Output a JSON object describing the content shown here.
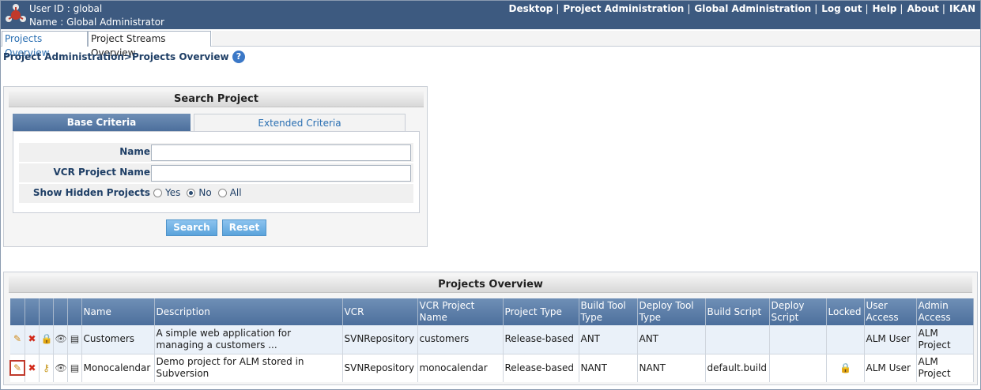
{
  "header": {
    "user_id": "User ID : global",
    "name": "Name : Global Administrator",
    "nav": [
      "Desktop",
      "Project Administration",
      "Global Administration",
      "Log out",
      "Help",
      "About",
      "IKAN"
    ],
    "nav_separator": "|",
    "bg_color": "#3d5a80"
  },
  "tabs": [
    "Projects Overview",
    "Project Streams Overview"
  ],
  "breadcrumb": "Project Administration>Projects Overview",
  "help_icon": "?",
  "search": {
    "title": "Search Project",
    "tab_base": "Base Criteria",
    "tab_extended": "Extended Criteria",
    "name_label": "Name",
    "name_value": "",
    "vcr_label": "VCR Project Name",
    "vcr_value": "",
    "hidden_label": "Show Hidden Projects",
    "options": [
      "Yes",
      "No",
      "All"
    ],
    "selected_option": "No",
    "search_button": "Search",
    "reset_button": "Reset"
  },
  "projects": {
    "title": "Projects Overview",
    "columns": [
      "",
      "",
      "",
      "",
      "",
      "Name",
      "Description",
      "VCR",
      "VCR Project Name",
      "Project Type",
      "Build Tool Type",
      "Deploy Tool Type",
      "Build Script",
      "Deploy Script",
      "Locked",
      "User Access",
      "Admin Access"
    ],
    "rows": [
      {
        "name": "Customers",
        "description": "A simple web application for managing a customers ...",
        "vcr": "SVNRepository",
        "vcr_project_name": "customers",
        "project_type": "Release-based",
        "build_tool_type": "ANT",
        "deploy_tool_type": "ANT",
        "build_script": "",
        "deploy_script": "",
        "locked": "",
        "user_access": "ALM User",
        "admin_access": "ALM Project",
        "icons": [
          "edit-icon",
          "delete-icon",
          "lock-icon",
          "view-icon",
          "details-icon"
        ]
      },
      {
        "name": "Monocalendar",
        "description": "Demo project for ALM stored in Subversion",
        "vcr": "SVNRepository",
        "vcr_project_name": "monocalendar",
        "project_type": "Release-based",
        "build_tool_type": "NANT",
        "deploy_tool_type": "NANT",
        "build_script": "default.build",
        "deploy_script": "",
        "locked": "locked-icon",
        "user_access": "ALM User",
        "admin_access": "ALM Project",
        "icons": [
          "edit-icon",
          "delete-icon",
          "key-icon",
          "view-icon",
          "details-icon"
        ]
      }
    ]
  }
}
